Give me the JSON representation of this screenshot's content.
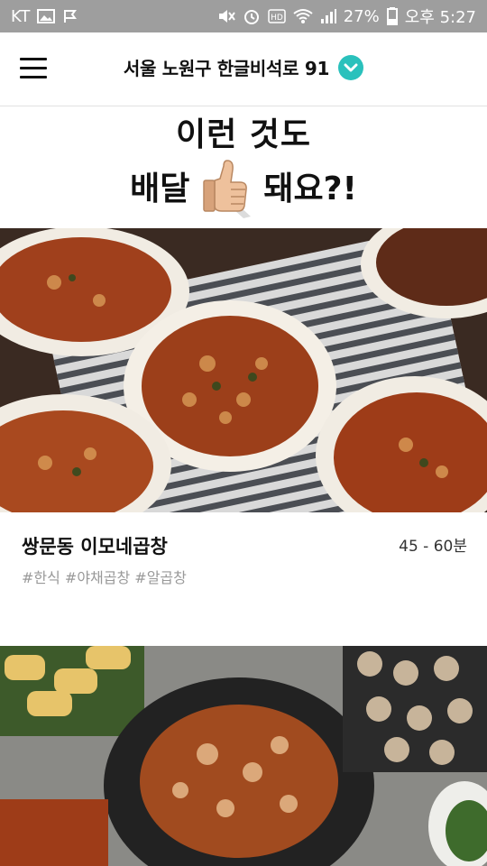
{
  "status_bar": {
    "carrier": "KT",
    "battery": "27%",
    "time": "오후 5:27"
  },
  "header": {
    "address": "서울 노원구 한글비석로 91",
    "accent_color": "#2ac1bc",
    "menu_icon": "hamburger-icon",
    "dropdown_icon": "chevron-down-icon"
  },
  "promo": {
    "line1": "이런 것도",
    "line2_left": "배달",
    "line2_right": "돼요?!",
    "icon": "thumbs-up-icon"
  },
  "restaurants": [
    {
      "name": "쌍문동 이모네곱창",
      "delivery_time": "45 - 60분",
      "tags": "#한식 #야채곱창 #알곱창"
    }
  ]
}
